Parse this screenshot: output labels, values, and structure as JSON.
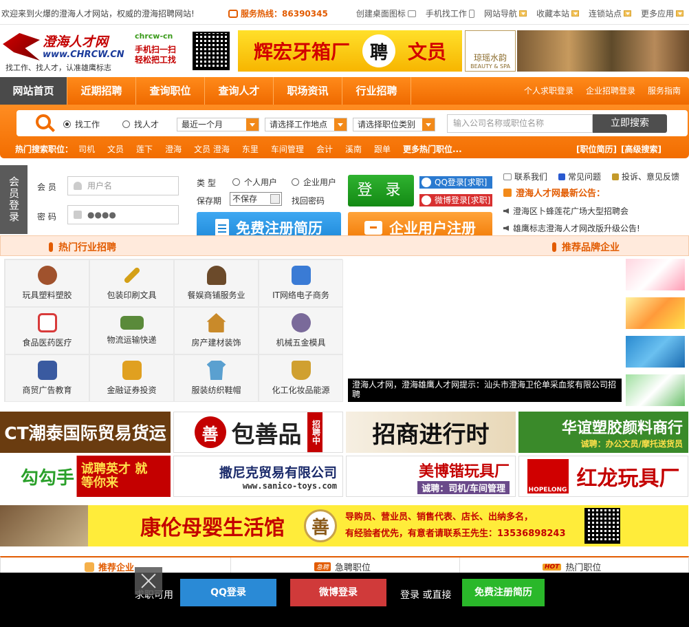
{
  "topbar": {
    "welcome": "欢迎来到火爆的澄海人才网站，权威的澄海招聘网站!",
    "hotline_label": "服务热线：",
    "hotline_number": "86390345",
    "links": [
      "创建桌面图标",
      "手机找工作",
      "网站导航",
      "收藏本站",
      "连锁站点",
      "更多应用"
    ]
  },
  "header": {
    "logo_title": "澄海人才网",
    "logo_url": "www.CHRCW.CN",
    "logo_slogan": "找工作、找人才，认准雄鹰标志",
    "wechat_id": "chrcw-cn",
    "wechat_line1": "手机扫一扫",
    "wechat_line2": "轻松把工找",
    "ad_left": "辉宏牙箱厂",
    "ad_pin": "聘",
    "ad_right": "文员",
    "ad2_text": "琼瑶水韵",
    "ad2_sub": "BEAUTY & SPA"
  },
  "nav": {
    "items": [
      "网站首页",
      "近期招聘",
      "查询职位",
      "查询人才",
      "职场资讯",
      "行业招聘"
    ],
    "right": [
      "个人求职登录",
      "企业招聘登录",
      "服务指南"
    ]
  },
  "search": {
    "type_job": "找工作",
    "type_talent": "找人才",
    "period": "最近一个月",
    "location": "请选择工作地点",
    "category": "请选择职位类别",
    "keyword_placeholder": "输入公司名称或职位名称",
    "button": "立即搜索",
    "hot_label": "热门搜索职位：",
    "hot_words": [
      "司机",
      "文员",
      "莲下",
      "澄海",
      "文员 澄海",
      "东里",
      "车间管理",
      "会计",
      "溪南",
      "跟单"
    ],
    "more": "更多热门职位...",
    "links": [
      "[职位简历]",
      "[高级搜索]"
    ]
  },
  "member": {
    "tab": "会员登录",
    "user_label": "会  员",
    "user_placeholder": "用户名",
    "pwd_label": "密  码",
    "pwd_value": "●●●●",
    "type_label": "类  型",
    "personal": "个人用户",
    "company": "企业用户",
    "keep_label": "保存期",
    "keep_value": "不保存",
    "find_pwd": "找回密码",
    "login": "登 录",
    "qq_login": "QQ登录[求职]",
    "weibo_login": "微博登录[求职]",
    "reg_resume": "免费注册简历",
    "reg_company": "企业用户注册"
  },
  "announce": {
    "links": [
      "联系我们",
      "常见问题",
      "投诉、意见反馈"
    ],
    "title": "澄海人才网最新公告：",
    "items": [
      "澄海区卜蜂莲花广场大型招聘会",
      "雄鹰标志澄海人才网改版升级公告!"
    ]
  },
  "sections": {
    "industry": "热门行业招聘",
    "brands": "推荐品牌企业"
  },
  "industries": [
    {
      "label": "玩具塑料塑胶",
      "color": "#a0522d"
    },
    {
      "label": "包装印刷文具",
      "color": "#d4a017"
    },
    {
      "label": "餐娱商铺服务业",
      "color": "#6b4a2a"
    },
    {
      "label": "IT网络电子商务",
      "color": "#3a7bd5"
    },
    {
      "label": "食品医药医疗",
      "color": "#d83a3a"
    },
    {
      "label": "物流运输快递",
      "color": "#5a8a3a"
    },
    {
      "label": "房产建材装饰",
      "color": "#c98a2a"
    },
    {
      "label": "机械五金模具",
      "color": "#7a6a9a"
    },
    {
      "label": "商贸广告教育",
      "color": "#3a5aa0"
    },
    {
      "label": "金融证券投资",
      "color": "#e0a020"
    },
    {
      "label": "服装纺织鞋帽",
      "color": "#5aa0d0"
    },
    {
      "label": "化工化妆品能源",
      "color": "#d0a030"
    }
  ],
  "notice_text": "澄海人才网，澄海雄鹰人才网提示：汕头市澄海卫伦单采血浆有限公司招聘",
  "banners": {
    "b1": "CT潮泰国际贸易货运",
    "b2_mark": "善",
    "b2": "包善品",
    "b2_tag": "招聘中",
    "b3": "招商进行时",
    "b4": "华谊塑胶颜料商行",
    "b4_sub": "诚聘：办公文员/摩托送货员",
    "b5": "勾勾手",
    "b5_sub": "诚聘英才 就等你来",
    "b6": "撒尼克贸易有限公司",
    "b6_url": "www.sanico-toys.com",
    "b7": "美博锴玩具厂",
    "b7_sub": "诚聘：司机/车间管理",
    "b8": "红龙玩具厂",
    "b8_brand": "HOPELONG",
    "b9": "康伦母婴生活馆",
    "b9_jobs": "导购员、营业员、销售代表、店长、出纳多名，",
    "b9_contact": "有经验者优先，有意者请联系王先生：13536898243"
  },
  "tabs": [
    "推荐企业",
    "急聘职位",
    "热门职位"
  ],
  "bottom": {
    "prefix": "求职可用",
    "qq": "QQ登录",
    "weibo": "微博登录",
    "mid": "登录  或直接",
    "reg": "免费注册简历"
  }
}
